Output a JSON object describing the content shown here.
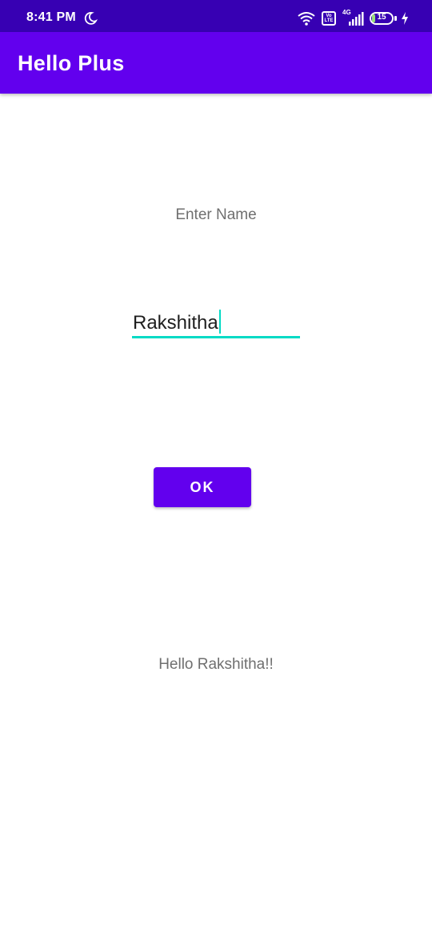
{
  "status_bar": {
    "time": "8:41 PM",
    "network_type": "4G",
    "volte_label": "Vo LTE",
    "battery_level": "15",
    "battery_fraction": 0.15,
    "color": "#3700B3"
  },
  "app_bar": {
    "title": "Hello Plus",
    "color": "#6200EE"
  },
  "form": {
    "label": "Enter Name",
    "name_value": "Rakshitha",
    "ok_label": "OK",
    "accent_color": "#03DAC5"
  },
  "output": {
    "greeting": "Hello Rakshitha!!"
  }
}
